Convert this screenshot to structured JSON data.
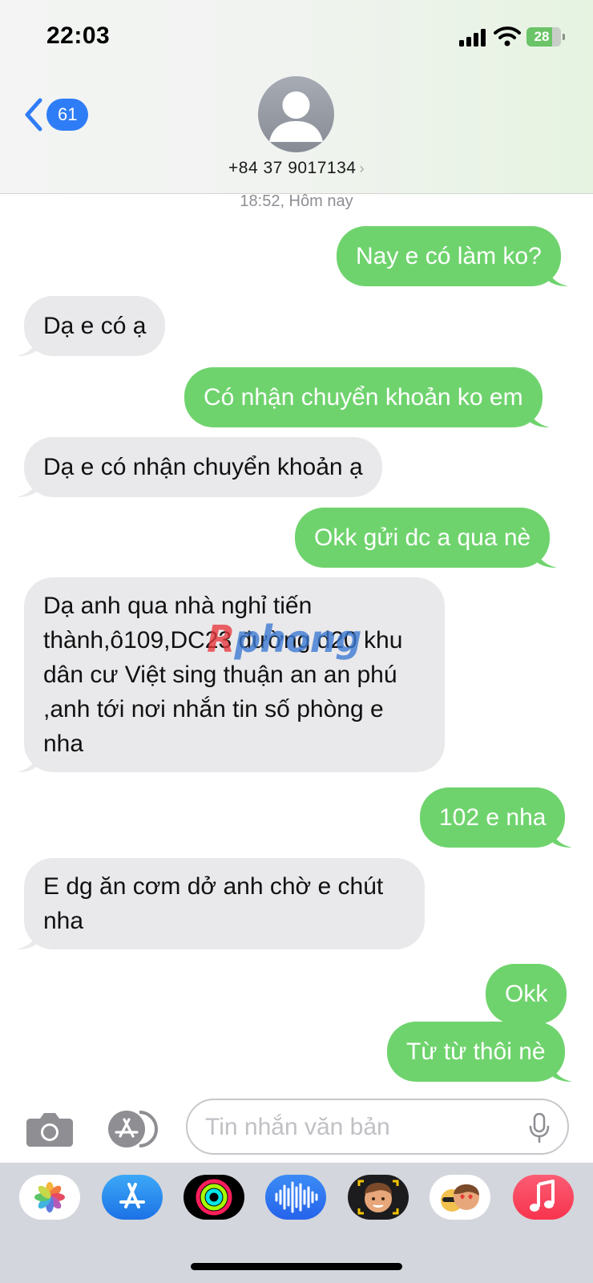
{
  "status_bar": {
    "time": "22:03",
    "battery_level": "28",
    "battery_fraction": 0.28,
    "battery_color": "#6bc468",
    "icons": [
      "signal-icon",
      "wifi-icon",
      "battery-charging-icon"
    ]
  },
  "header": {
    "back_badge": "61",
    "contact_name": "+84 37 9017134",
    "chevron": "›",
    "accent_color": "#2f7df6"
  },
  "conversation": {
    "timestamp": "18:52, Hôm nay",
    "outgoing_color": "#6fd36d",
    "incoming_color": "#e9e9eb",
    "messages": [
      {
        "direction": "out",
        "text": "Nay e có làm ko?"
      },
      {
        "direction": "in",
        "text": "Dạ e có ạ"
      },
      {
        "direction": "out",
        "text": "Có nhận chuyển khoản ko em"
      },
      {
        "direction": "in",
        "text": "Dạ e có nhận chuyển khoản ạ"
      },
      {
        "direction": "out",
        "text": "Okk gửi dc a qua nè"
      },
      {
        "direction": "in",
        "text": "Dạ anh qua nhà nghỉ tiến thành,ô109,DC23 đường d20 khu dân cư Việt sing thuận an an phú ,anh tới nơi nhắn tin số phòng e nha"
      },
      {
        "direction": "out",
        "text": "102 e nha"
      },
      {
        "direction": "in",
        "text": "E dg ăn cơm dở anh chờ e chút nha"
      },
      {
        "direction": "out",
        "text": "Okk"
      },
      {
        "direction": "out",
        "text": "Từ từ thôi nè"
      }
    ]
  },
  "watermark": {
    "part1": "R",
    "part2": "phong"
  },
  "input_bar": {
    "placeholder": "Tin nhắn văn bản",
    "icons": [
      "camera-icon",
      "app-store-icon",
      "microphone-icon"
    ]
  },
  "app_drawer": {
    "apps": [
      "photos-app-icon",
      "app-store-app-icon",
      "fitness-app-icon",
      "voice-memo-app-icon",
      "memoji-app-icon",
      "memoji-stickers-app-icon",
      "music-app-icon"
    ]
  }
}
